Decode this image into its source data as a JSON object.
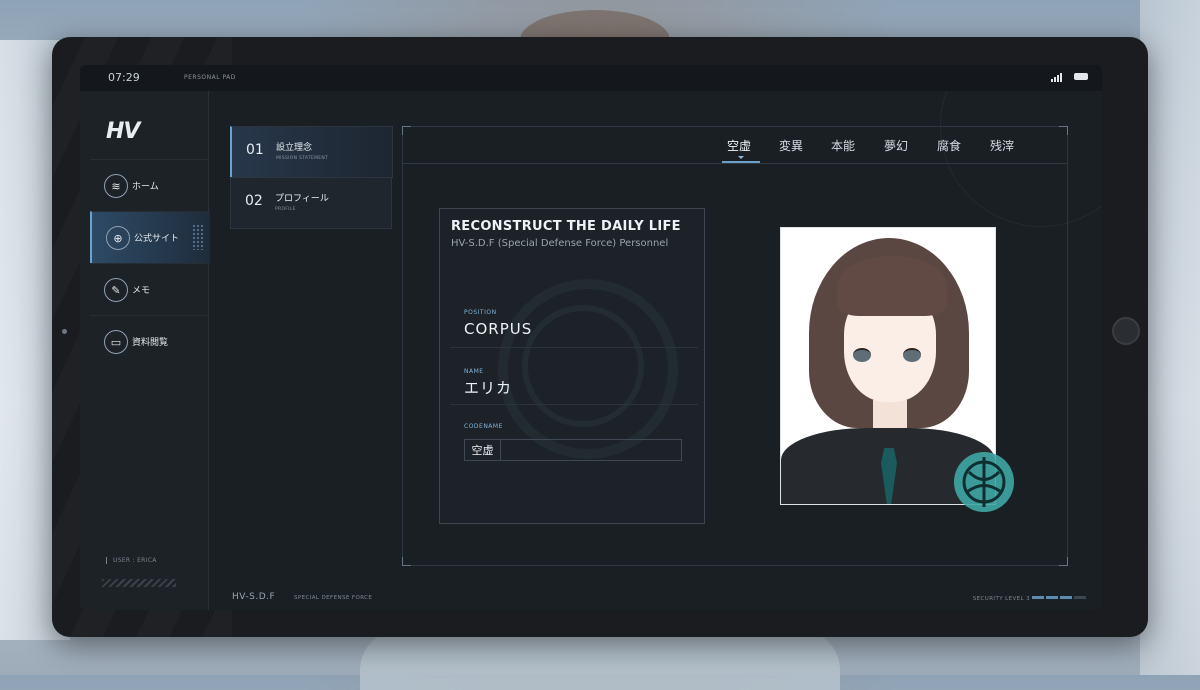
{
  "status": {
    "time": "07:29",
    "device": "PERSONAL PAD"
  },
  "sidebar": {
    "logo": "HV",
    "items": [
      {
        "label": "ホーム",
        "icon": "layers-icon"
      },
      {
        "label": "公式サイト",
        "icon": "globe-icon"
      },
      {
        "label": "メモ",
        "icon": "edit-icon"
      },
      {
        "label": "資料閲覧",
        "icon": "folder-icon"
      }
    ],
    "user": "USER : ERICA"
  },
  "submenu": [
    {
      "num": "01",
      "title": "設立理念",
      "caption": "MISSION STATEMENT"
    },
    {
      "num": "02",
      "title": "プロフィール",
      "caption": "PROFILE"
    }
  ],
  "tabs": [
    "空虚",
    "変異",
    "本能",
    "夢幻",
    "腐食",
    "残滓"
  ],
  "card": {
    "title": "RECONSTRUCT THE DAILY LIFE",
    "subtitle": "HV-S.D.F (Special Defense Force) Personnel",
    "position_label": "POSITION",
    "position_value": "CORPUS",
    "name_label": "NAME",
    "name_value": "エリカ",
    "codename_label": "CODENAME",
    "codename_value": "空虚"
  },
  "footer": {
    "left": "HV-S.D.F",
    "mid": "SPECIAL DEFENSE FORCE",
    "right": "SECURITY LEVEL 3",
    "security_level": 3
  },
  "colors": {
    "accent": "#6da4cf",
    "badge": "#3fa7a4"
  }
}
